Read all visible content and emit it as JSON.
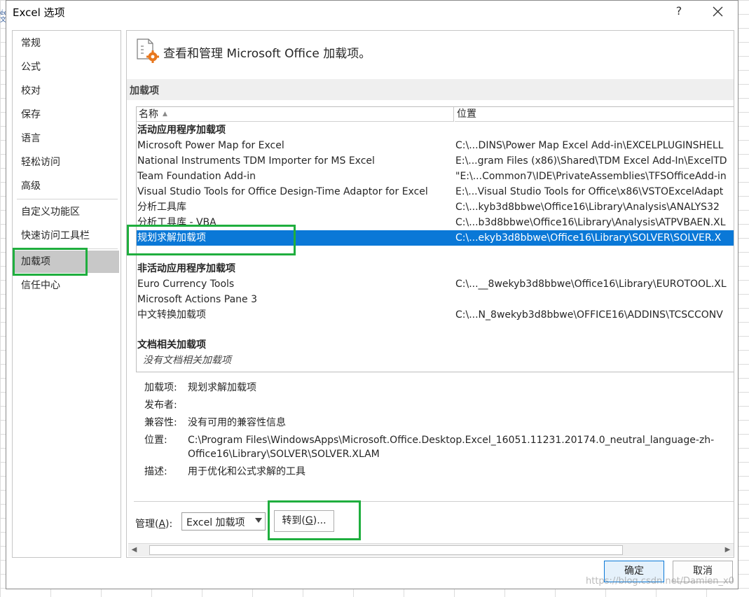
{
  "window": {
    "title": "Excel 选项",
    "help_label": "?"
  },
  "sheet_edge_text": "ée\n文",
  "nav": {
    "items": [
      {
        "label": "常规"
      },
      {
        "label": "公式"
      },
      {
        "label": "校对"
      },
      {
        "label": "保存"
      },
      {
        "label": "语言"
      },
      {
        "label": "轻松访问"
      },
      {
        "label": "高级"
      },
      {
        "label": "自定义功能区"
      },
      {
        "label": "快速访问工具栏"
      },
      {
        "label": "加载项",
        "active": true
      },
      {
        "label": "信任中心"
      }
    ]
  },
  "header": {
    "text": "查看和管理 Microsoft Office 加载项。",
    "icon": "addin-gear-icon"
  },
  "section": {
    "label": "加载项"
  },
  "table": {
    "col_name": "名称",
    "col_location": "位置",
    "groups": [
      {
        "title": "活动应用程序加载项",
        "rows": [
          {
            "name": "Microsoft Power Map for Excel",
            "location": "C:\\...DINS\\Power Map Excel Add-in\\EXCELPLUGINSHELL"
          },
          {
            "name": "National Instruments TDM Importer for MS Excel",
            "location": "E:\\...gram Files (x86)\\Shared\\TDM Excel Add-In\\ExcelTD"
          },
          {
            "name": "Team Foundation Add-in",
            "location": "\"E:\\...Common7\\IDE\\PrivateAssemblies\\TFSOfficeAdd-in"
          },
          {
            "name": "Visual Studio Tools for Office Design-Time Adaptor for Excel",
            "location": "E:\\...Visual Studio Tools for Office\\x86\\VSTOExcelAdapt"
          },
          {
            "name": "分析工具库",
            "location": "C:\\...kyb3d8bbwe\\Office16\\Library\\Analysis\\ANALYS32"
          },
          {
            "name": "分析工具库 - VBA",
            "location": "C:\\...b3d8bbwe\\Office16\\Library\\Analysis\\ATPVBAEN.XL"
          },
          {
            "name": "规划求解加载项",
            "location": "C:\\...ekyb3d8bbwe\\Office16\\Library\\SOLVER\\SOLVER.X",
            "selected": true
          }
        ]
      },
      {
        "title": "非活动应用程序加载项",
        "rows": [
          {
            "name": "Euro Currency Tools",
            "location": "C:\\...__8wekyb3d8bbwe\\Office16\\Library\\EUROTOOL.XL"
          },
          {
            "name": "Microsoft Actions Pane 3",
            "location": ""
          },
          {
            "name": "中文转换加载项",
            "location": "C:\\...N_8wekyb3d8bbwe\\OFFICE16\\ADDINS\\TCSCCONV"
          }
        ]
      },
      {
        "title": "文档相关加载项",
        "note": "没有文档相关加载项"
      }
    ]
  },
  "details": {
    "addin_label": "加载项:",
    "addin_value": "规划求解加载项",
    "publisher_label": "发布者:",
    "publisher_value": "",
    "compat_label": "兼容性:",
    "compat_value": "没有可用的兼容性信息",
    "location_label": "位置:",
    "location_value_line1": "C:\\Program Files\\WindowsApps\\Microsoft.Office.Desktop.Excel_16051.11231.20174.0_neutral_language-zh-",
    "location_value_line2": "Office16\\Library\\SOLVER\\SOLVER.XLAM",
    "desc_label": "描述:",
    "desc_value": "用于优化和公式求解的工具"
  },
  "manage": {
    "label_prefix": "管理(",
    "label_key": "A",
    "label_suffix": "):",
    "selected": "Excel 加载项",
    "go_prefix": "转到(",
    "go_key": "G",
    "go_suffix": ")..."
  },
  "footer": {
    "ok": "确定",
    "cancel": "取消"
  },
  "watermark": "https://blog.csdn.net/Damien_x0"
}
